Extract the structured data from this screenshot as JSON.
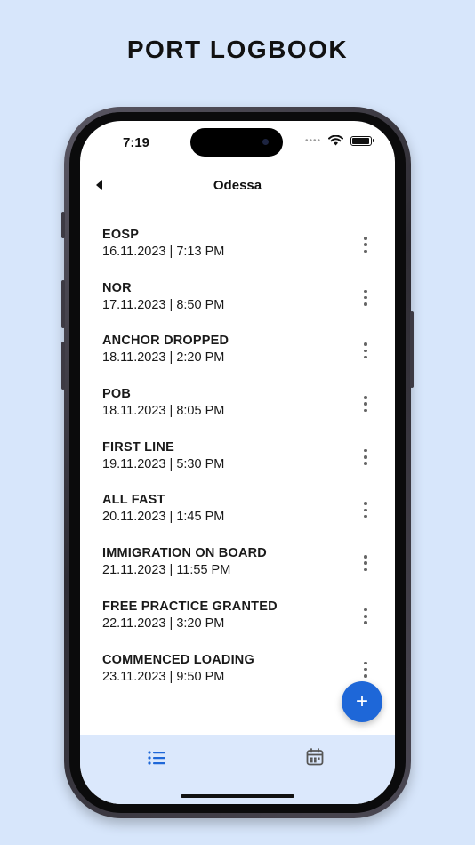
{
  "headline": "PORT LOGBOOK",
  "status_bar": {
    "time": "7:19"
  },
  "nav": {
    "title": "Odessa"
  },
  "entries": [
    {
      "title": "EOSP",
      "datetime": "16.11.2023 | 7:13 PM"
    },
    {
      "title": "NOR",
      "datetime": "17.11.2023 | 8:50 PM"
    },
    {
      "title": "ANCHOR DROPPED",
      "datetime": "18.11.2023 | 2:20 PM"
    },
    {
      "title": "POB",
      "datetime": "18.11.2023 | 8:05 PM"
    },
    {
      "title": "FIRST LINE",
      "datetime": "19.11.2023 | 5:30 PM"
    },
    {
      "title": "ALL FAST",
      "datetime": "20.11.2023 | 1:45 PM"
    },
    {
      "title": "IMMIGRATION ON BOARD",
      "datetime": "21.11.2023 | 11:55 PM"
    },
    {
      "title": "FREE PRACTICE GRANTED",
      "datetime": "22.11.2023 | 3:20 PM"
    },
    {
      "title": "COMMENCED LOADING",
      "datetime": "23.11.2023 | 9:50 PM"
    }
  ],
  "fab": {
    "icon": "plus-icon",
    "label": "+"
  },
  "tabbar": {
    "tabs": [
      {
        "icon": "list-icon",
        "active": true
      },
      {
        "icon": "calendar-icon",
        "active": false
      }
    ]
  },
  "colors": {
    "background": "#d7e6fb",
    "accent": "#1e67d8",
    "tabbar": "#dbe8fc"
  }
}
